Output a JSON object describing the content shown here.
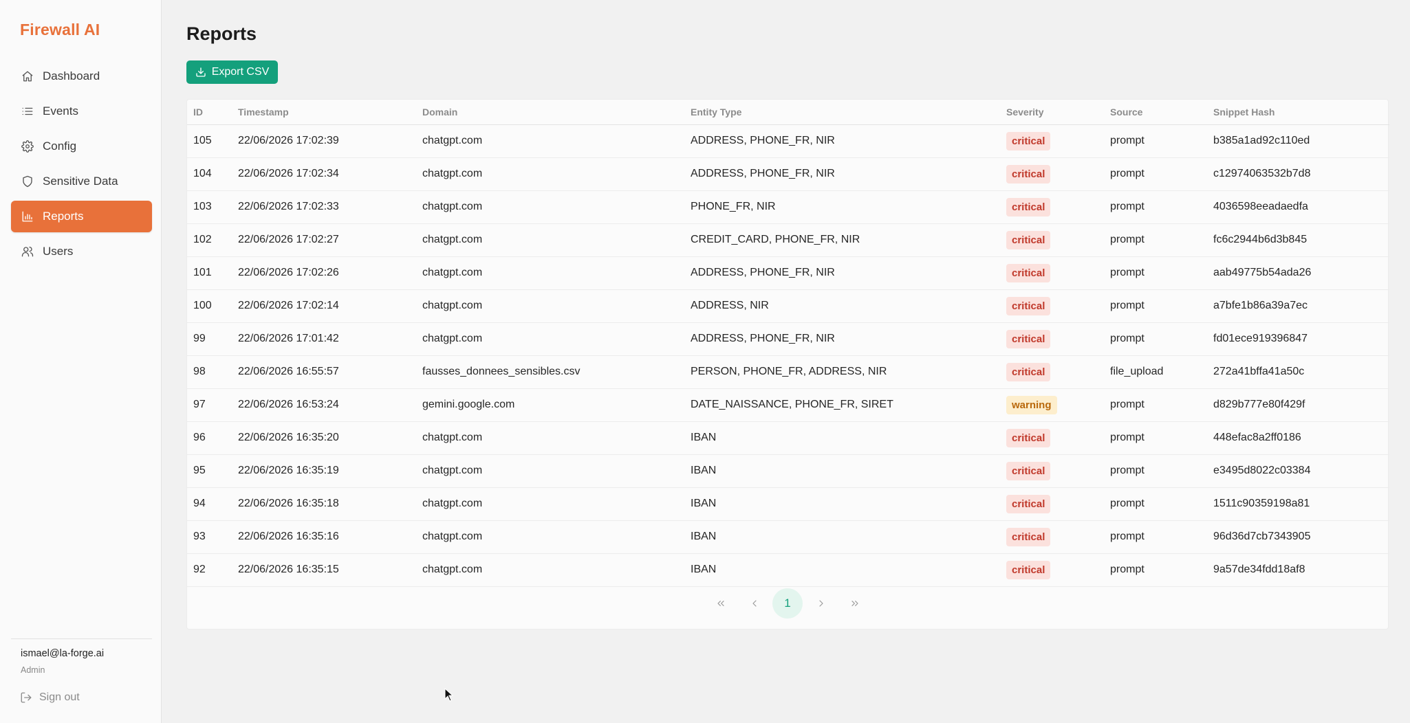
{
  "app": {
    "brand": "Firewall AI"
  },
  "sidebar": {
    "items": [
      {
        "label": "Dashboard",
        "icon": "home-icon"
      },
      {
        "label": "Events",
        "icon": "list-icon"
      },
      {
        "label": "Config",
        "icon": "gear-icon"
      },
      {
        "label": "Sensitive Data",
        "icon": "shield-icon"
      },
      {
        "label": "Reports",
        "icon": "bar-chart-icon",
        "active": true
      },
      {
        "label": "Users",
        "icon": "users-icon"
      }
    ],
    "user": {
      "email": "ismael@la-forge.ai",
      "role": "Admin"
    },
    "signout_label": "Sign out"
  },
  "page": {
    "title": "Reports",
    "export_label": "Export CSV"
  },
  "colors": {
    "accent": "#e8713a",
    "primary_button": "#14a07c",
    "critical_bg": "#fbe1dd",
    "critical_text": "#c0392b",
    "warning_bg": "#fdeecd",
    "warning_text": "#b9690c"
  },
  "table": {
    "columns": [
      "ID",
      "Timestamp",
      "Domain",
      "Entity Type",
      "Severity",
      "Source",
      "Snippet Hash"
    ],
    "rows": [
      [
        "105",
        "22/06/2026 17:02:39",
        "chatgpt.com",
        "ADDRESS, PHONE_FR, NIR",
        "critical",
        "prompt",
        "b385a1ad92c110ed"
      ],
      [
        "104",
        "22/06/2026 17:02:34",
        "chatgpt.com",
        "ADDRESS, PHONE_FR, NIR",
        "critical",
        "prompt",
        "c12974063532b7d8"
      ],
      [
        "103",
        "22/06/2026 17:02:33",
        "chatgpt.com",
        "PHONE_FR, NIR",
        "critical",
        "prompt",
        "4036598eeadaedfa"
      ],
      [
        "102",
        "22/06/2026 17:02:27",
        "chatgpt.com",
        "CREDIT_CARD, PHONE_FR, NIR",
        "critical",
        "prompt",
        "fc6c2944b6d3b845"
      ],
      [
        "101",
        "22/06/2026 17:02:26",
        "chatgpt.com",
        "ADDRESS, PHONE_FR, NIR",
        "critical",
        "prompt",
        "aab49775b54ada26"
      ],
      [
        "100",
        "22/06/2026 17:02:14",
        "chatgpt.com",
        "ADDRESS, NIR",
        "critical",
        "prompt",
        "a7bfe1b86a39a7ec"
      ],
      [
        "99",
        "22/06/2026 17:01:42",
        "chatgpt.com",
        "ADDRESS, PHONE_FR, NIR",
        "critical",
        "prompt",
        "fd01ece919396847"
      ],
      [
        "98",
        "22/06/2026 16:55:57",
        "fausses_donnees_sensibles.csv",
        "PERSON, PHONE_FR, ADDRESS, NIR",
        "critical",
        "file_upload",
        "272a41bffa41a50c"
      ],
      [
        "97",
        "22/06/2026 16:53:24",
        "gemini.google.com",
        "DATE_NAISSANCE, PHONE_FR, SIRET",
        "warning",
        "prompt",
        "d829b777e80f429f"
      ],
      [
        "96",
        "22/06/2026 16:35:20",
        "chatgpt.com",
        "IBAN",
        "critical",
        "prompt",
        "448efac8a2ff0186"
      ],
      [
        "95",
        "22/06/2026 16:35:19",
        "chatgpt.com",
        "IBAN",
        "critical",
        "prompt",
        "e3495d8022c03384"
      ],
      [
        "94",
        "22/06/2026 16:35:18",
        "chatgpt.com",
        "IBAN",
        "critical",
        "prompt",
        "1511c90359198a81"
      ],
      [
        "93",
        "22/06/2026 16:35:16",
        "chatgpt.com",
        "IBAN",
        "critical",
        "prompt",
        "96d36d7cb7343905"
      ],
      [
        "92",
        "22/06/2026 16:35:15",
        "chatgpt.com",
        "IBAN",
        "critical",
        "prompt",
        "9a57de34fdd18af8"
      ]
    ]
  },
  "pagination": {
    "current_page": "1"
  }
}
